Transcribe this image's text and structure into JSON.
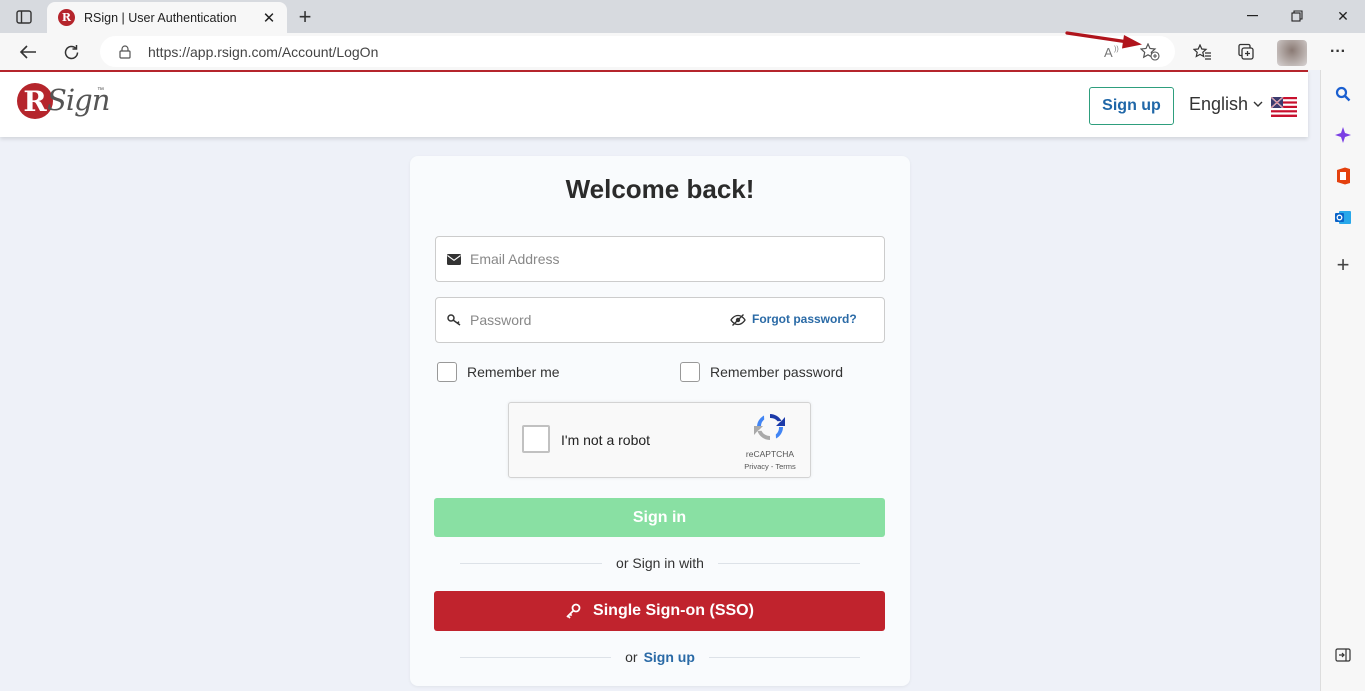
{
  "browser": {
    "tab_title": "RSign | User Authentication",
    "url": "https://app.rsign.com/Account/LogOn",
    "icons": [
      "tab-actions-icon",
      "back-arrow-icon",
      "refresh-icon",
      "lock-icon",
      "read-aloud-icon",
      "add-favorite-icon",
      "favorites-icon",
      "collections-icon",
      "more-icon",
      "minimize-icon",
      "restore-icon",
      "close-icon"
    ]
  },
  "header": {
    "logo_letter": "R",
    "logo_text": "Sign",
    "logo_tm": "™",
    "signup_label": "Sign up",
    "language": "English"
  },
  "login": {
    "title": "Welcome back!",
    "email_placeholder": "Email Address",
    "password_placeholder": "Password",
    "forgot_label": "Forgot password?",
    "remember_me": "Remember me",
    "remember_password": "Remember password",
    "captcha_label": "I'm not a robot",
    "captcha_brand": "reCAPTCHA",
    "captcha_links": "Privacy - Terms",
    "signin_label": "Sign in",
    "or_signin_with": "or Sign in with",
    "sso_label": "Single Sign-on (SSO)",
    "or_label": "or",
    "signup_link": "Sign up"
  },
  "colors": {
    "brand_red": "#b5252c",
    "signin_green": "#89e0a3",
    "sso_red": "#c0232d",
    "link_blue": "#2a6aa6",
    "annotation_arrow": "#b0141c"
  }
}
